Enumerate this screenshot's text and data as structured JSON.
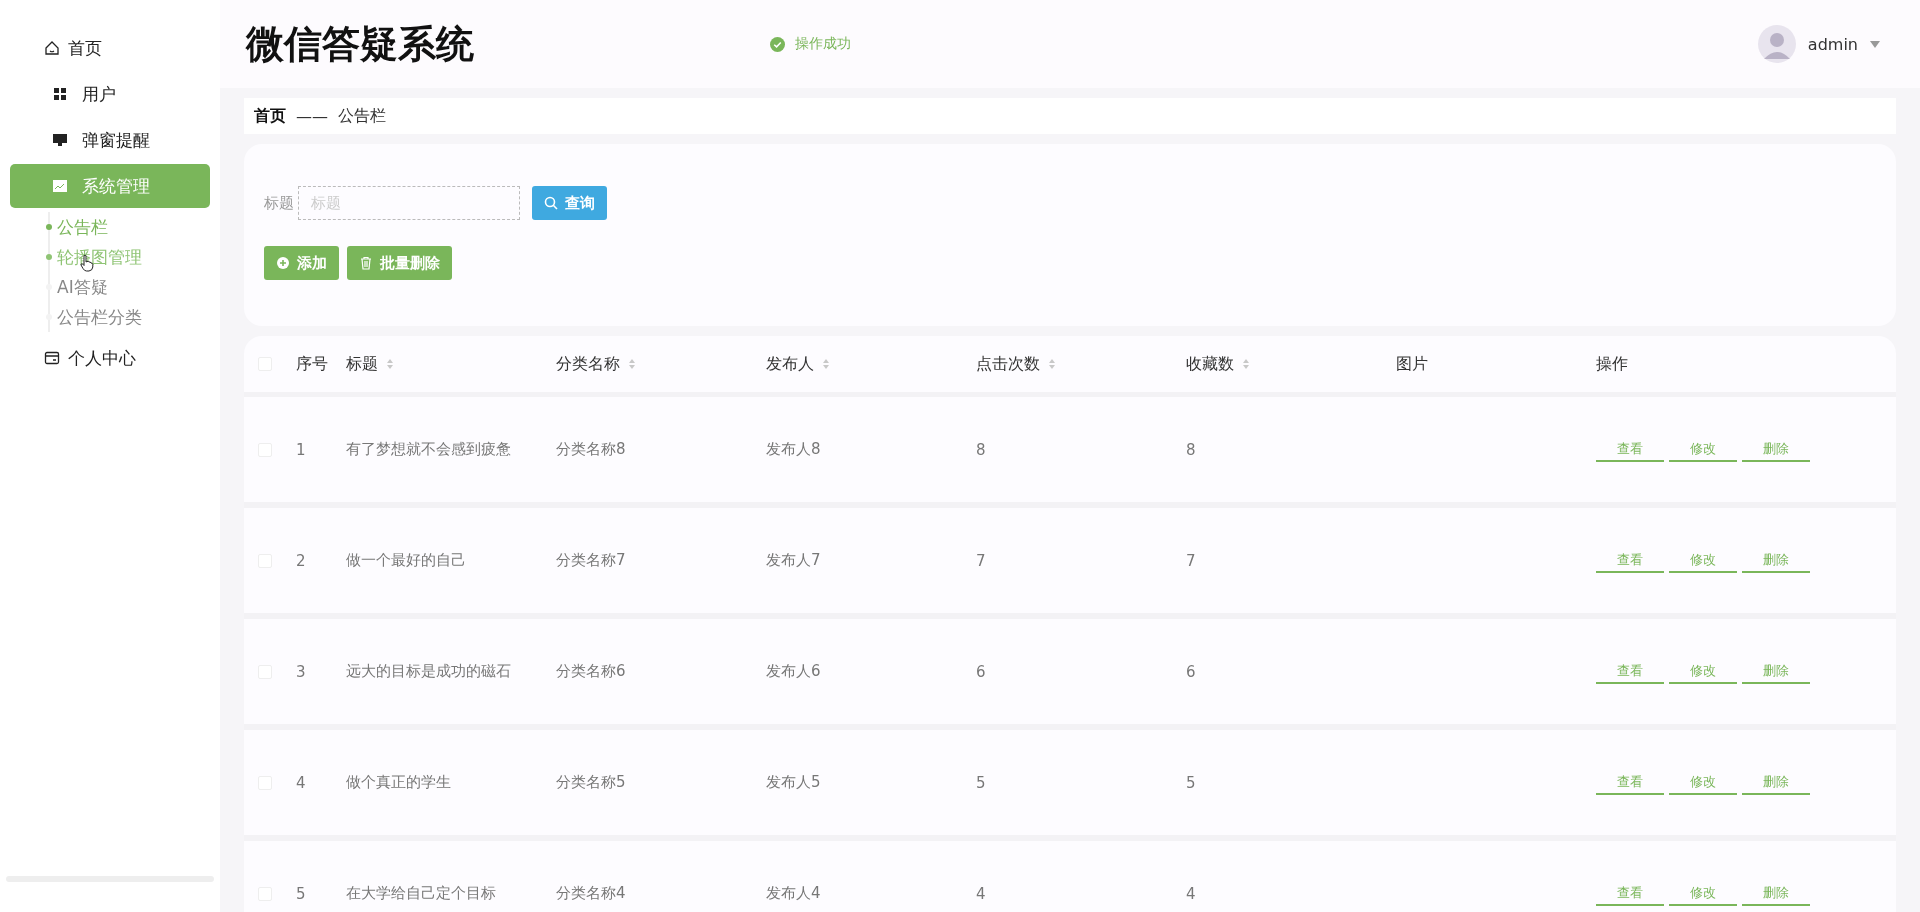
{
  "sidebar": {
    "items": [
      {
        "label": "首页",
        "selected": false
      },
      {
        "label": "用户",
        "selected": false
      },
      {
        "label": "弹窗提醒",
        "selected": false
      },
      {
        "label": "系统管理",
        "selected": true,
        "children": [
          {
            "label": "公告栏",
            "selected": true,
            "hover": false
          },
          {
            "label": "轮播图管理",
            "selected": false,
            "hover": true
          },
          {
            "label": "AI答疑",
            "selected": false,
            "hover": false
          },
          {
            "label": "公告栏分类",
            "selected": false,
            "hover": false
          }
        ]
      },
      {
        "label": "个人中心",
        "selected": false
      }
    ]
  },
  "header": {
    "title": "微信答疑系统",
    "message": "操作成功",
    "user": "admin"
  },
  "breadcrumb": {
    "home": "首页",
    "separator": "——",
    "current": "公告栏"
  },
  "search": {
    "label": "标题",
    "placeholder": "标题",
    "button": "查询"
  },
  "actions": [
    "添加",
    "批量删除"
  ],
  "table": {
    "header_checked": false,
    "columns": [
      {
        "label": "序号",
        "sortable": false
      },
      {
        "label": "标题",
        "sortable": true
      },
      {
        "label": "分类名称",
        "sortable": true
      },
      {
        "label": "发布人",
        "sortable": true
      },
      {
        "label": "点击次数",
        "sortable": true
      },
      {
        "label": "收藏数",
        "sortable": true
      },
      {
        "label": "图片",
        "sortable": false
      },
      {
        "label": "操作",
        "sortable": false
      }
    ],
    "rows": [
      {
        "checked": false,
        "cells": [
          "1",
          "有了梦想就不会感到疲惫",
          "分类名称8",
          "发布人8",
          "8",
          "8"
        ],
        "buttons": [
          "查看",
          "修改",
          "删除"
        ]
      },
      {
        "checked": false,
        "cells": [
          "2",
          "做一个最好的自己",
          "分类名称7",
          "发布人7",
          "7",
          "7"
        ],
        "buttons": [
          "查看",
          "修改",
          "删除"
        ]
      },
      {
        "checked": false,
        "cells": [
          "3",
          "远大的目标是成功的磁石",
          "分类名称6",
          "发布人6",
          "6",
          "6"
        ],
        "buttons": [
          "查看",
          "修改",
          "删除"
        ]
      },
      {
        "checked": false,
        "cells": [
          "4",
          "做个真正的学生",
          "分类名称5",
          "发布人5",
          "5",
          "5"
        ],
        "buttons": [
          "查看",
          "修改",
          "删除"
        ]
      },
      {
        "checked": false,
        "cells": [
          "5",
          "在大学给自己定个目标",
          "分类名称4",
          "发布人4",
          "4",
          "4"
        ],
        "buttons": [
          "查看",
          "修改",
          "删除"
        ]
      }
    ]
  }
}
